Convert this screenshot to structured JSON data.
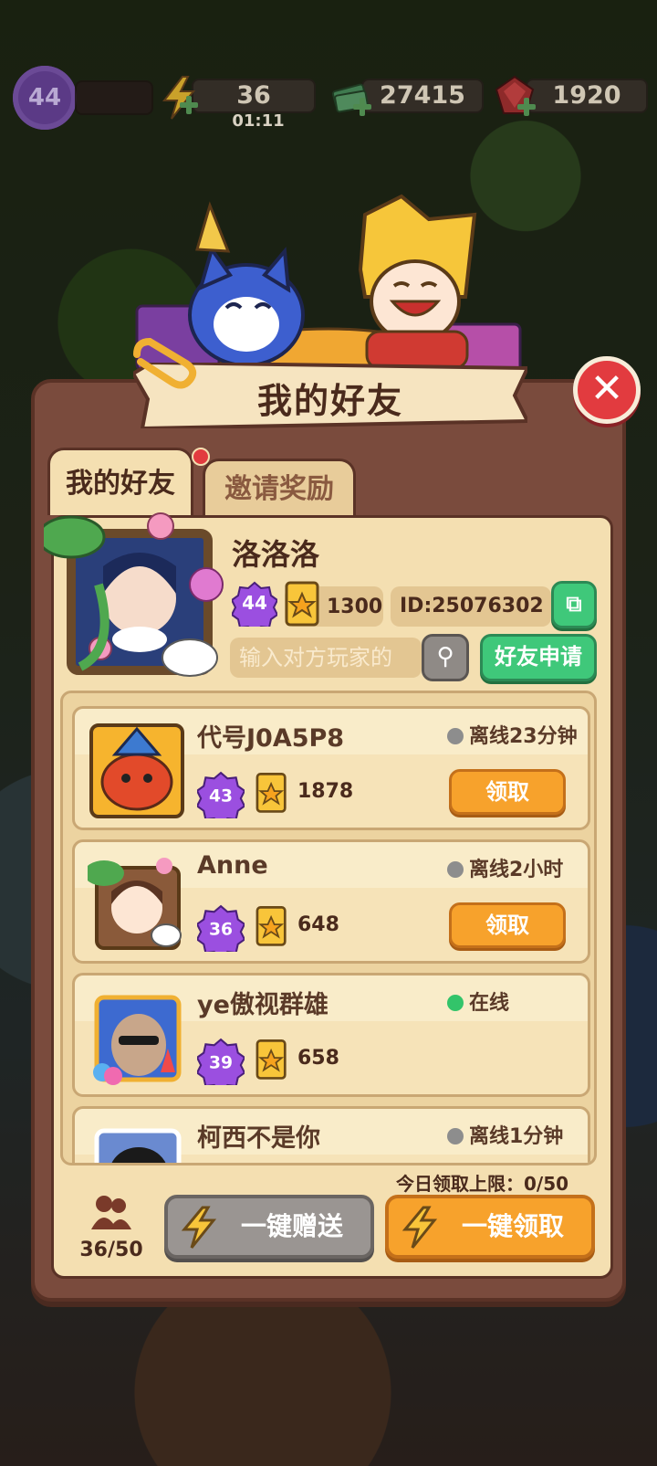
{
  "top_bar": {
    "level": "44",
    "energy": "36",
    "energy_timer": "01:11",
    "cash": "27415",
    "gems": "1920"
  },
  "dialog": {
    "title": "我的好友",
    "close_icon": "close-icon"
  },
  "tabs": [
    {
      "label": "我的好友",
      "active": true,
      "has_notification": true
    },
    {
      "label": "邀请奖励",
      "active": false
    }
  ],
  "profile": {
    "name": "洛洛洛",
    "level": "44",
    "score": "1300",
    "id": "ID:25076302",
    "search_placeholder": "输入对方玩家的",
    "add_friend_label": "好友申请"
  },
  "friends": [
    {
      "name": "代号J0A5P8",
      "status": "离线23分钟",
      "online": false,
      "level": "43",
      "score": "1878",
      "action": "领取"
    },
    {
      "name": "Anne",
      "status": "离线2小时",
      "online": false,
      "level": "36",
      "score": "648",
      "action": "领取"
    },
    {
      "name": "ye傲视群雄",
      "status": "在线",
      "online": true,
      "level": "39",
      "score": "658",
      "action": ""
    },
    {
      "name": "柯西不是你",
      "status": "离线1分钟",
      "online": false,
      "level": "",
      "score": "",
      "action": ""
    }
  ],
  "footer": {
    "daily_limit": "今日领取上限：0/50",
    "friend_count": "36/50",
    "gift_all_label": "一键赠送",
    "claim_all_label": "一键领取"
  },
  "colors": {
    "panel": "#7a4b3d",
    "panel_inner": "#f4dfb1",
    "orange_button": "#f7a22c",
    "green_button": "#3fc87a",
    "gray_button": "#9a9592",
    "close_red": "#e23b3f"
  }
}
